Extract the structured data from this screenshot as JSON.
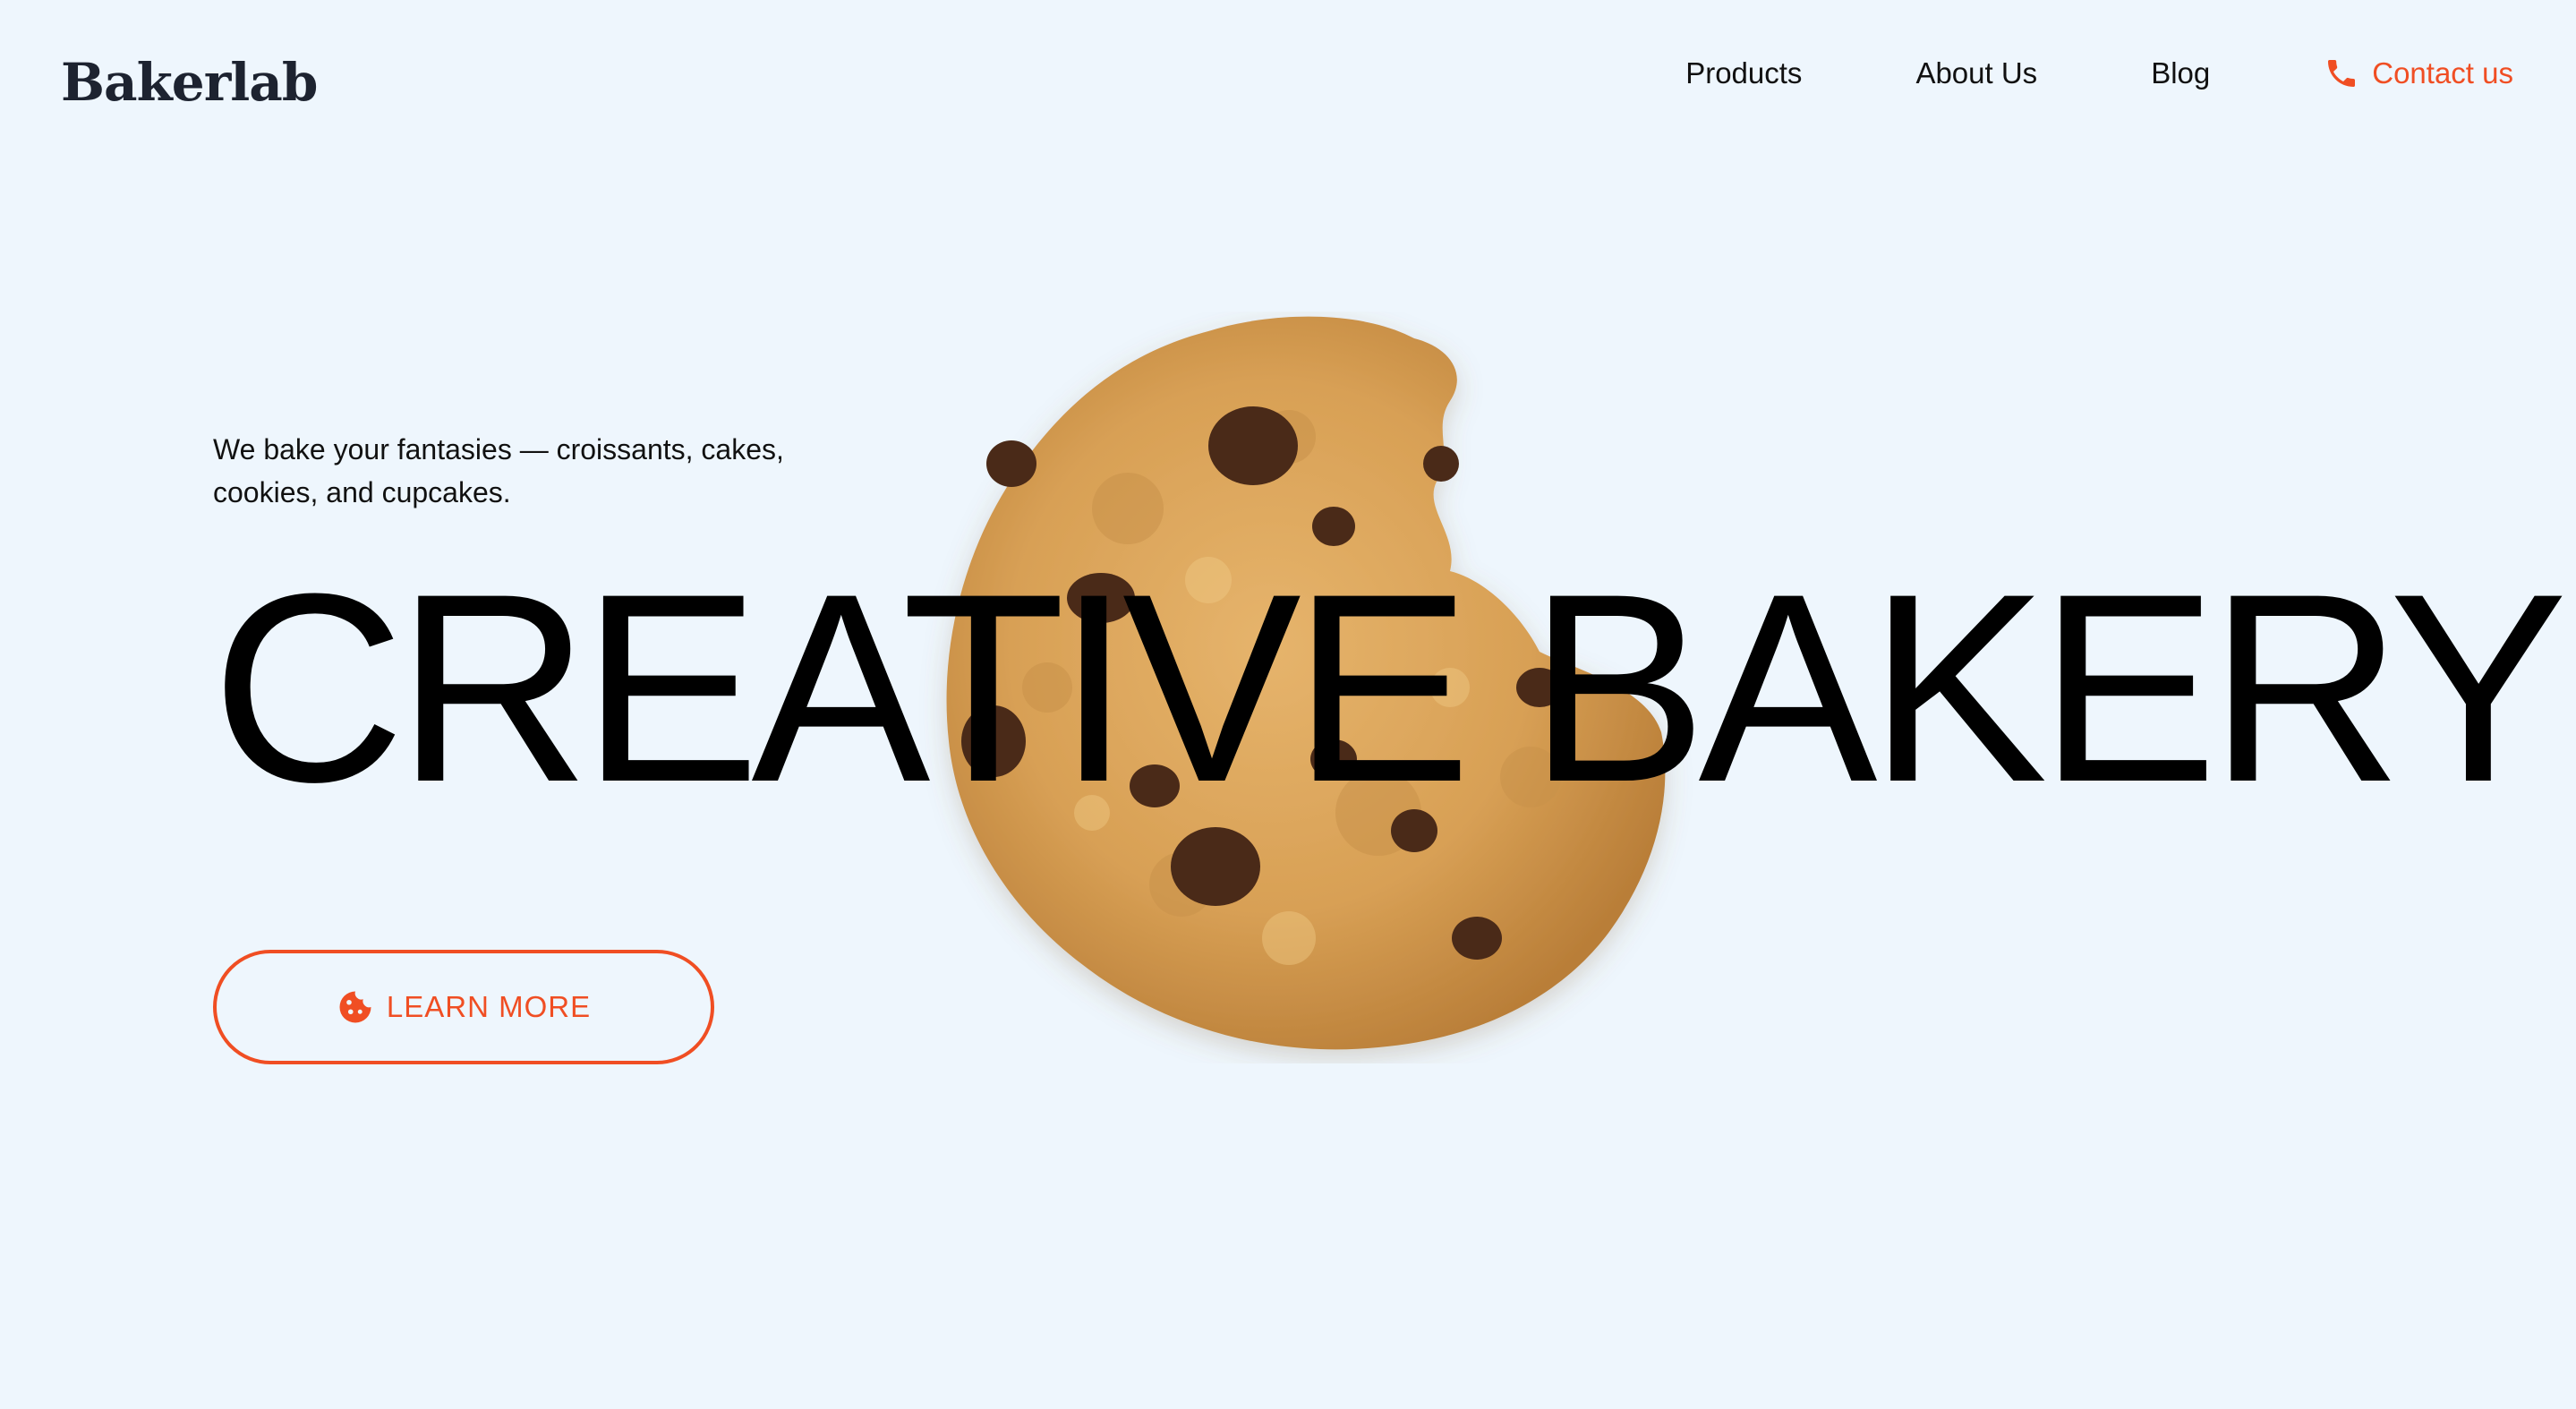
{
  "brand": {
    "name": "Bakerlab"
  },
  "nav": {
    "items": [
      {
        "label": "Products"
      },
      {
        "label": "About Us"
      },
      {
        "label": "Blog"
      }
    ],
    "contact": {
      "label": "Contact us",
      "icon": "phone-icon"
    }
  },
  "hero": {
    "tagline": "We bake your fantasies — croissants, cakes, cookies, and cupcakes.",
    "headline": "CREATIVE BAKERY",
    "cta": {
      "label": "LEARN MORE",
      "icon": "cookie-icon"
    },
    "image": "chocolate-chip-cookie"
  },
  "colors": {
    "background": "#eef6fd",
    "accent": "#f04e23",
    "text": "#111111"
  }
}
